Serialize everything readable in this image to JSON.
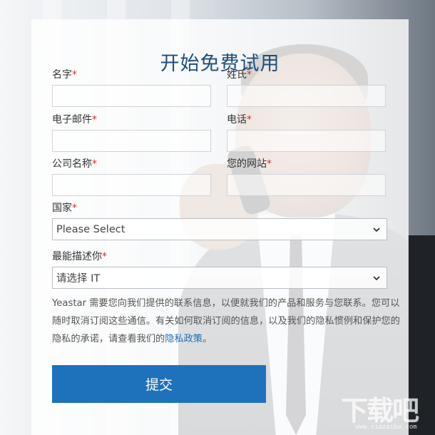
{
  "form": {
    "title": "开始免费试用",
    "required_mark": "*",
    "first_name_label": "名字",
    "last_name_label": "姓氏",
    "email_label": "电子邮件",
    "phone_label": "电话",
    "company_label": "公司名称",
    "website_label": "您的网站",
    "country_label": "国家",
    "country_value": "Please Select",
    "role_label": "最能描述你",
    "role_value": "请选择 IT",
    "notice_text": "Yeastar 需要您向我们提供的联系信息，以便就我们的产品和服务与您联系。您可以随时取消订阅这些通信。有关如何取消订阅的信息，以及我们的隐私惯例和保护您的隐私的承诺，请查看我们的",
    "privacy_link": "隐私政策",
    "notice_end": "。",
    "submit_label": "提交"
  },
  "watermark": {
    "text": "下载吧",
    "url": "www.xiazaiba.com"
  },
  "colors": {
    "accent": "#1e72bb",
    "title": "#1d4f7d",
    "required": "#d0342c"
  }
}
